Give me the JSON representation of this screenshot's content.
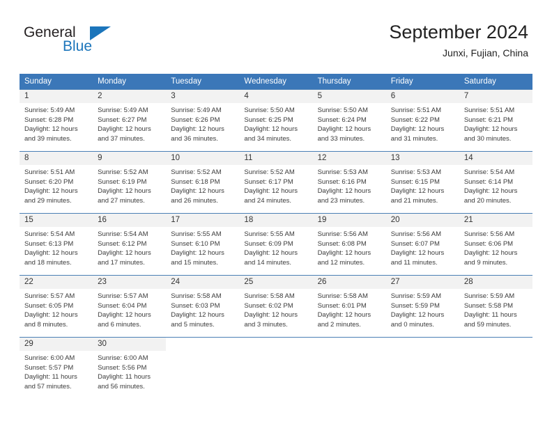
{
  "brand": {
    "name_top": "General",
    "name_bottom": "Blue",
    "triangle_color": "#1b75bb"
  },
  "header": {
    "title": "September 2024",
    "subtitle": "Junxi, Fujian, China"
  },
  "theme": {
    "header_blue": "#3b77b8",
    "daynum_bg": "#f2f2f2",
    "text": "#3a3a3a"
  },
  "calendar": {
    "weekday_headers": [
      "Sunday",
      "Monday",
      "Tuesday",
      "Wednesday",
      "Thursday",
      "Friday",
      "Saturday"
    ],
    "labels": {
      "sunrise": "Sunrise:",
      "sunset": "Sunset:",
      "daylight": "Daylight:"
    },
    "weeks": [
      [
        {
          "day": "1",
          "sunrise": "Sunrise: 5:49 AM",
          "sunset": "Sunset: 6:28 PM",
          "daylight": "Daylight: 12 hours and 39 minutes."
        },
        {
          "day": "2",
          "sunrise": "Sunrise: 5:49 AM",
          "sunset": "Sunset: 6:27 PM",
          "daylight": "Daylight: 12 hours and 37 minutes."
        },
        {
          "day": "3",
          "sunrise": "Sunrise: 5:49 AM",
          "sunset": "Sunset: 6:26 PM",
          "daylight": "Daylight: 12 hours and 36 minutes."
        },
        {
          "day": "4",
          "sunrise": "Sunrise: 5:50 AM",
          "sunset": "Sunset: 6:25 PM",
          "daylight": "Daylight: 12 hours and 34 minutes."
        },
        {
          "day": "5",
          "sunrise": "Sunrise: 5:50 AM",
          "sunset": "Sunset: 6:24 PM",
          "daylight": "Daylight: 12 hours and 33 minutes."
        },
        {
          "day": "6",
          "sunrise": "Sunrise: 5:51 AM",
          "sunset": "Sunset: 6:22 PM",
          "daylight": "Daylight: 12 hours and 31 minutes."
        },
        {
          "day": "7",
          "sunrise": "Sunrise: 5:51 AM",
          "sunset": "Sunset: 6:21 PM",
          "daylight": "Daylight: 12 hours and 30 minutes."
        }
      ],
      [
        {
          "day": "8",
          "sunrise": "Sunrise: 5:51 AM",
          "sunset": "Sunset: 6:20 PM",
          "daylight": "Daylight: 12 hours and 29 minutes."
        },
        {
          "day": "9",
          "sunrise": "Sunrise: 5:52 AM",
          "sunset": "Sunset: 6:19 PM",
          "daylight": "Daylight: 12 hours and 27 minutes."
        },
        {
          "day": "10",
          "sunrise": "Sunrise: 5:52 AM",
          "sunset": "Sunset: 6:18 PM",
          "daylight": "Daylight: 12 hours and 26 minutes."
        },
        {
          "day": "11",
          "sunrise": "Sunrise: 5:52 AM",
          "sunset": "Sunset: 6:17 PM",
          "daylight": "Daylight: 12 hours and 24 minutes."
        },
        {
          "day": "12",
          "sunrise": "Sunrise: 5:53 AM",
          "sunset": "Sunset: 6:16 PM",
          "daylight": "Daylight: 12 hours and 23 minutes."
        },
        {
          "day": "13",
          "sunrise": "Sunrise: 5:53 AM",
          "sunset": "Sunset: 6:15 PM",
          "daylight": "Daylight: 12 hours and 21 minutes."
        },
        {
          "day": "14",
          "sunrise": "Sunrise: 5:54 AM",
          "sunset": "Sunset: 6:14 PM",
          "daylight": "Daylight: 12 hours and 20 minutes."
        }
      ],
      [
        {
          "day": "15",
          "sunrise": "Sunrise: 5:54 AM",
          "sunset": "Sunset: 6:13 PM",
          "daylight": "Daylight: 12 hours and 18 minutes."
        },
        {
          "day": "16",
          "sunrise": "Sunrise: 5:54 AM",
          "sunset": "Sunset: 6:12 PM",
          "daylight": "Daylight: 12 hours and 17 minutes."
        },
        {
          "day": "17",
          "sunrise": "Sunrise: 5:55 AM",
          "sunset": "Sunset: 6:10 PM",
          "daylight": "Daylight: 12 hours and 15 minutes."
        },
        {
          "day": "18",
          "sunrise": "Sunrise: 5:55 AM",
          "sunset": "Sunset: 6:09 PM",
          "daylight": "Daylight: 12 hours and 14 minutes."
        },
        {
          "day": "19",
          "sunrise": "Sunrise: 5:56 AM",
          "sunset": "Sunset: 6:08 PM",
          "daylight": "Daylight: 12 hours and 12 minutes."
        },
        {
          "day": "20",
          "sunrise": "Sunrise: 5:56 AM",
          "sunset": "Sunset: 6:07 PM",
          "daylight": "Daylight: 12 hours and 11 minutes."
        },
        {
          "day": "21",
          "sunrise": "Sunrise: 5:56 AM",
          "sunset": "Sunset: 6:06 PM",
          "daylight": "Daylight: 12 hours and 9 minutes."
        }
      ],
      [
        {
          "day": "22",
          "sunrise": "Sunrise: 5:57 AM",
          "sunset": "Sunset: 6:05 PM",
          "daylight": "Daylight: 12 hours and 8 minutes."
        },
        {
          "day": "23",
          "sunrise": "Sunrise: 5:57 AM",
          "sunset": "Sunset: 6:04 PM",
          "daylight": "Daylight: 12 hours and 6 minutes."
        },
        {
          "day": "24",
          "sunrise": "Sunrise: 5:58 AM",
          "sunset": "Sunset: 6:03 PM",
          "daylight": "Daylight: 12 hours and 5 minutes."
        },
        {
          "day": "25",
          "sunrise": "Sunrise: 5:58 AM",
          "sunset": "Sunset: 6:02 PM",
          "daylight": "Daylight: 12 hours and 3 minutes."
        },
        {
          "day": "26",
          "sunrise": "Sunrise: 5:58 AM",
          "sunset": "Sunset: 6:01 PM",
          "daylight": "Daylight: 12 hours and 2 minutes."
        },
        {
          "day": "27",
          "sunrise": "Sunrise: 5:59 AM",
          "sunset": "Sunset: 5:59 PM",
          "daylight": "Daylight: 12 hours and 0 minutes."
        },
        {
          "day": "28",
          "sunrise": "Sunrise: 5:59 AM",
          "sunset": "Sunset: 5:58 PM",
          "daylight": "Daylight: 11 hours and 59 minutes."
        }
      ],
      [
        {
          "day": "29",
          "sunrise": "Sunrise: 6:00 AM",
          "sunset": "Sunset: 5:57 PM",
          "daylight": "Daylight: 11 hours and 57 minutes."
        },
        {
          "day": "30",
          "sunrise": "Sunrise: 6:00 AM",
          "sunset": "Sunset: 5:56 PM",
          "daylight": "Daylight: 11 hours and 56 minutes."
        },
        {
          "day": "",
          "sunrise": "",
          "sunset": "",
          "daylight": ""
        },
        {
          "day": "",
          "sunrise": "",
          "sunset": "",
          "daylight": ""
        },
        {
          "day": "",
          "sunrise": "",
          "sunset": "",
          "daylight": ""
        },
        {
          "day": "",
          "sunrise": "",
          "sunset": "",
          "daylight": ""
        },
        {
          "day": "",
          "sunrise": "",
          "sunset": "",
          "daylight": ""
        }
      ]
    ]
  }
}
